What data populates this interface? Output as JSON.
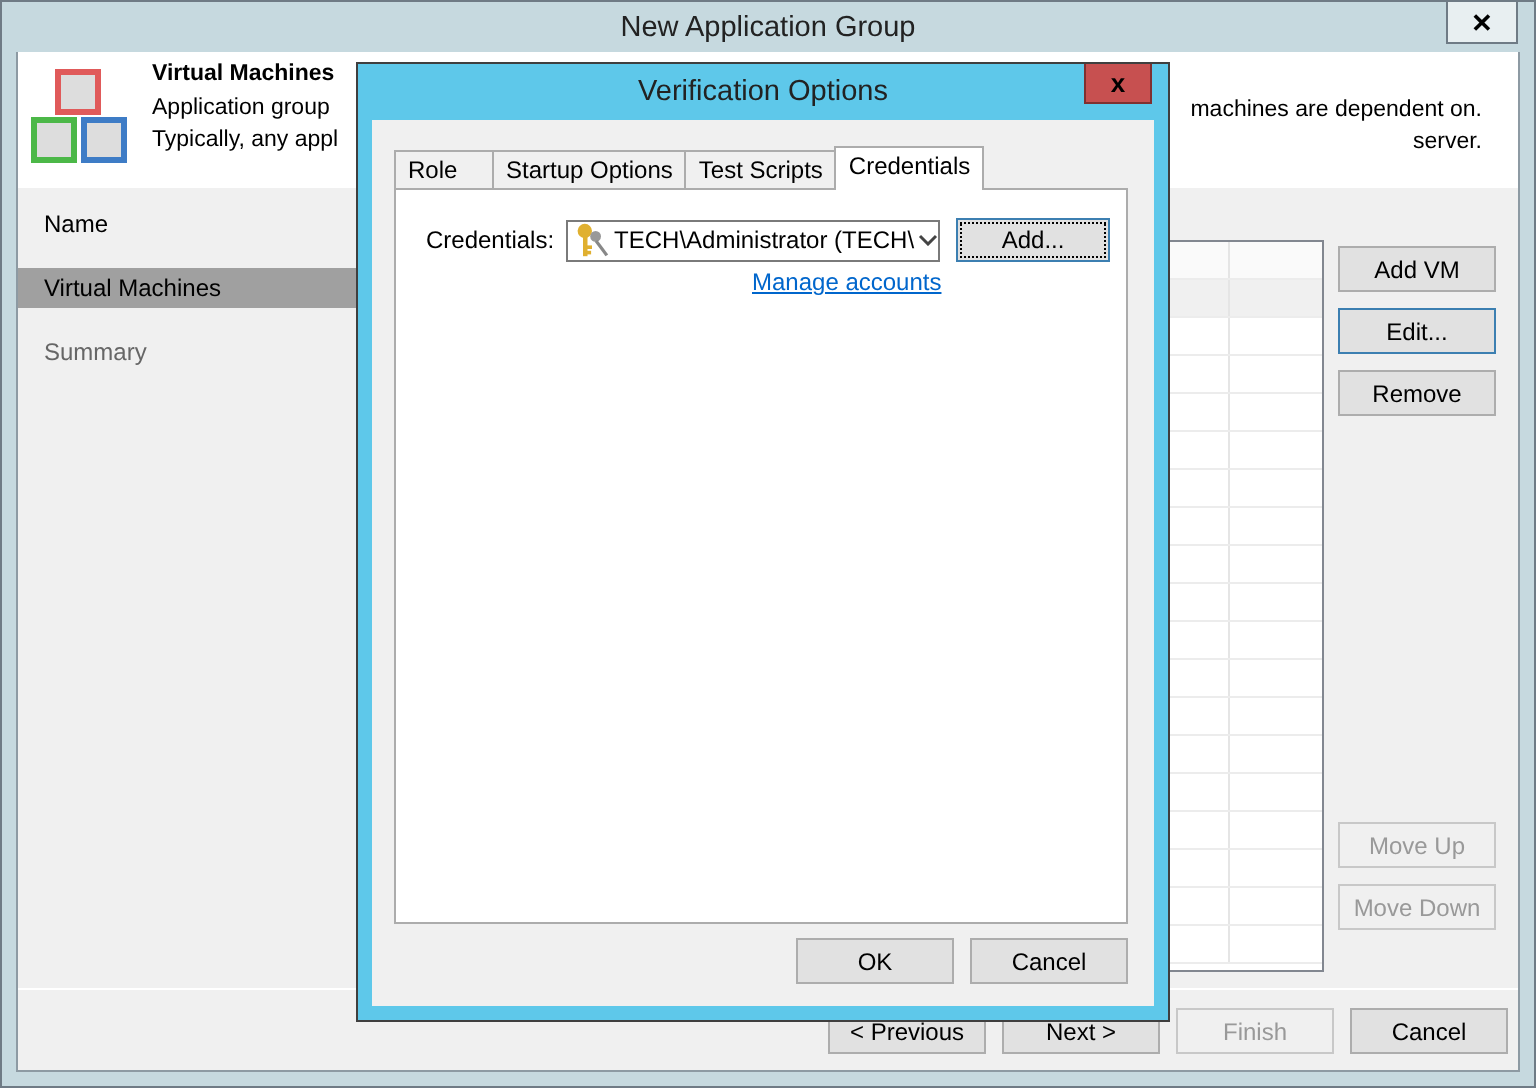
{
  "window": {
    "title": "New Application Group",
    "close": "✕"
  },
  "header": {
    "title": "Virtual Machines",
    "left_lines": [
      "Application group",
      "Typically, any appl"
    ],
    "right_lines": [
      "machines are dependent on.",
      "server."
    ]
  },
  "sidebar": {
    "items": [
      {
        "label": "Name",
        "selected": false,
        "disabled": false
      },
      {
        "label": "Virtual Machines",
        "selected": true,
        "disabled": false
      },
      {
        "label": "Summary",
        "selected": false,
        "disabled": true
      }
    ]
  },
  "side_buttons": [
    {
      "label": "Add VM",
      "disabled": false,
      "focused": false
    },
    {
      "label": "Edit...",
      "disabled": false,
      "focused": true
    },
    {
      "label": "Remove",
      "disabled": false,
      "focused": false
    }
  ],
  "order_buttons": [
    {
      "label": "Move Up",
      "disabled": true
    },
    {
      "label": "Move Down",
      "disabled": true
    }
  ],
  "footer_buttons": [
    {
      "label": "< Previous",
      "disabled": false
    },
    {
      "label": "Next >",
      "disabled": false
    },
    {
      "label": "Finish",
      "disabled": true
    },
    {
      "label": "Cancel",
      "disabled": false
    }
  ],
  "dialog": {
    "title": "Verification Options",
    "close": "x",
    "tabs": [
      {
        "label": "Role",
        "selected": false
      },
      {
        "label": "Startup Options",
        "selected": false
      },
      {
        "label": "Test Scripts",
        "selected": false
      },
      {
        "label": "Credentials",
        "selected": true
      }
    ],
    "credentials_label": "Credentials:",
    "credentials_value": "TECH\\Administrator (TECH\\",
    "add_button": "Add...",
    "manage_link": "Manage accounts",
    "buttons": [
      "OK",
      "Cancel"
    ]
  }
}
